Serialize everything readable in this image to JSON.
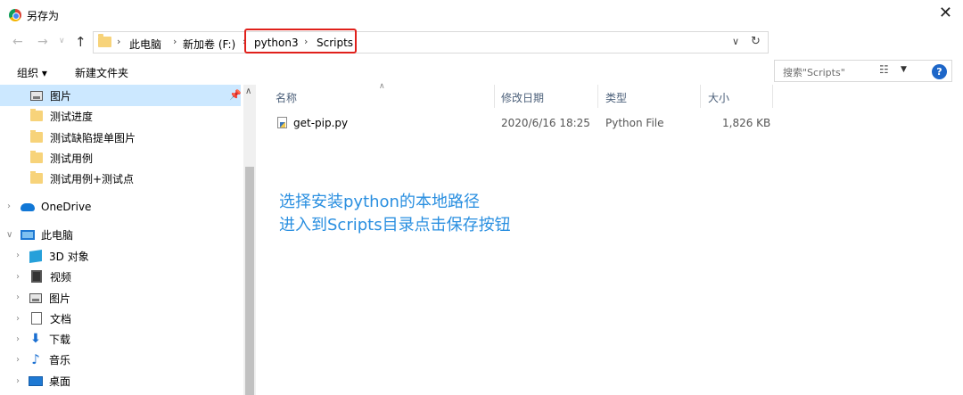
{
  "window": {
    "title": "另存为"
  },
  "address": {
    "crumbs": [
      "此电脑",
      "新加卷 (F:)",
      "python3",
      "Scripts"
    ]
  },
  "search": {
    "placeholder": "搜索\"Scripts\""
  },
  "toolbar": {
    "organize_label": "组织 ▾",
    "new_folder_label": "新建文件夹"
  },
  "sidebar": {
    "items": [
      {
        "label": "图片",
        "icon": "pictures-icon",
        "selected": true
      },
      {
        "label": "测试进度",
        "icon": "folder-icon"
      },
      {
        "label": "测试缺陷提单图片",
        "icon": "folder-icon"
      },
      {
        "label": "测试用例",
        "icon": "folder-icon"
      },
      {
        "label": "测试用例+测试点",
        "icon": "folder-icon"
      },
      {
        "label": "OneDrive",
        "icon": "onedrive-icon"
      },
      {
        "label": "此电脑",
        "icon": "this-pc-icon"
      },
      {
        "label": "3D 对象",
        "icon": "3d-objects-icon"
      },
      {
        "label": "视频",
        "icon": "videos-icon"
      },
      {
        "label": "图片",
        "icon": "pictures-icon"
      },
      {
        "label": "文档",
        "icon": "documents-icon"
      },
      {
        "label": "下载",
        "icon": "downloads-icon"
      },
      {
        "label": "音乐",
        "icon": "music-icon"
      },
      {
        "label": "桌面",
        "icon": "desktop-icon"
      }
    ]
  },
  "columns": {
    "name": "名称",
    "modified": "修改日期",
    "type": "类型",
    "size": "大小"
  },
  "files": [
    {
      "name": "get-pip.py",
      "modified": "2020/6/16 18:25",
      "type": "Python File",
      "size": "1,826 KB"
    }
  ],
  "annotation": {
    "line1": "选择安装python的本地路径",
    "line2": "进入到Scripts目录点击保存按钮"
  },
  "colors": {
    "highlight": "#e0201b",
    "annotation": "#2a8fe0",
    "selection": "#cce8ff"
  }
}
